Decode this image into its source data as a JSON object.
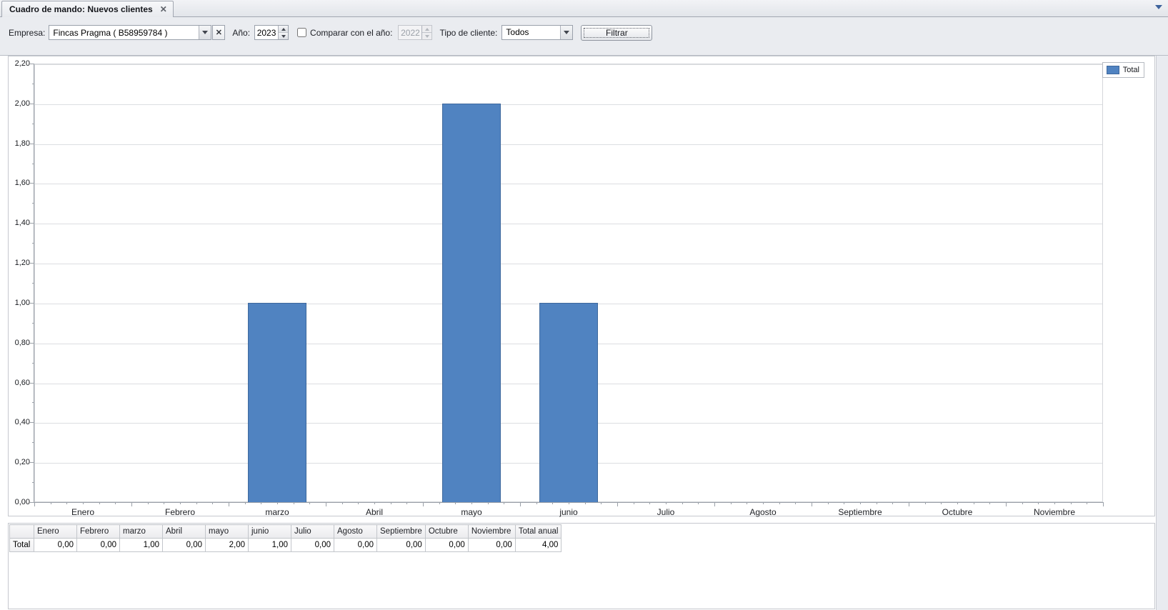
{
  "tab_bar": {
    "active_tab": "Cuadro de mando: Nuevos clientes",
    "close_icon": "✕",
    "overflow_icon": "▼"
  },
  "toolbar": {
    "empresa": {
      "label": "Empresa:",
      "value": "Fincas Pragma ( B58959784 )",
      "clear_icon": "✕"
    },
    "anio": {
      "label": "Año:",
      "value": "2023"
    },
    "comparar": {
      "label": "Comparar con el año:",
      "checked": false,
      "value": "2022",
      "enabled": false
    },
    "tipo_cliente": {
      "label": "Tipo de cliente:",
      "value": "Todos"
    },
    "filtrar": {
      "label": "Filtrar"
    }
  },
  "chart_data": {
    "type": "bar",
    "title": "",
    "xlabel": "",
    "ylabel": "",
    "categories": [
      "Enero",
      "Febrero",
      "marzo",
      "Abril",
      "mayo",
      "junio",
      "Julio",
      "Agosto",
      "Septiembre",
      "Octubre",
      "Noviembre"
    ],
    "series": [
      {
        "name": "Total",
        "values": [
          0,
          0,
          1,
          0,
          2,
          1,
          0,
          0,
          0,
          0,
          0
        ]
      }
    ],
    "ylim": [
      0,
      2.2
    ],
    "y_major_step": 0.2,
    "y_minor_step": 0.1,
    "y_tick_labels": [
      "0,00",
      "0,20",
      "0,40",
      "0,60",
      "0,80",
      "1,00",
      "1,20",
      "1,40",
      "1,60",
      "1,80",
      "2,00",
      "2,20"
    ],
    "grid": true,
    "legend": {
      "position": "top-right",
      "entries": [
        "Total"
      ]
    },
    "bar_color": "#5083c1",
    "bar_border_color": "#3e689d"
  },
  "table": {
    "corner_label": "",
    "columns": [
      "Enero",
      "Febrero",
      "marzo",
      "Abril",
      "mayo",
      "junio",
      "Julio",
      "Agosto",
      "Septiembre",
      "Octubre",
      "Noviembre",
      "Total anual"
    ],
    "rows": [
      {
        "label": "Total",
        "values": [
          "0,00",
          "0,00",
          "1,00",
          "0,00",
          "2,00",
          "1,00",
          "0,00",
          "0,00",
          "0,00",
          "0,00",
          "0,00",
          "4,00"
        ]
      }
    ]
  },
  "colors": {
    "accent_bar": "#5083c1",
    "bar_border": "#3e689d",
    "toolbar_bg": "#eaecf0",
    "panel_border": "#c5c8ce",
    "grid_line": "#dcdee1",
    "axis_line": "#9aa0a8"
  }
}
